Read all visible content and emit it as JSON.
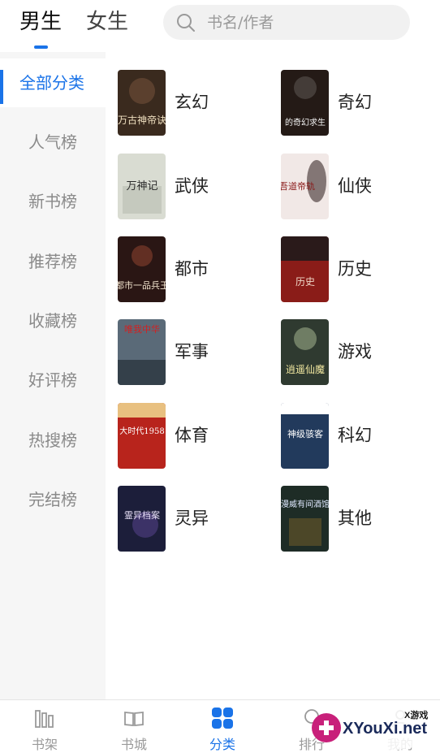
{
  "header": {
    "tabs": [
      {
        "label": "男生",
        "active": true
      },
      {
        "label": "女生",
        "active": false
      }
    ],
    "search": {
      "placeholder": "书名/作者",
      "value": ""
    }
  },
  "sidebar": {
    "items": [
      {
        "label": "全部分类",
        "active": true
      },
      {
        "label": "人气榜",
        "active": false
      },
      {
        "label": "新书榜",
        "active": false
      },
      {
        "label": "推荐榜",
        "active": false
      },
      {
        "label": "收藏榜",
        "active": false
      },
      {
        "label": "好评榜",
        "active": false
      },
      {
        "label": "热搜榜",
        "active": false
      },
      {
        "label": "完结榜",
        "active": false
      }
    ]
  },
  "categories": [
    {
      "label": "玄幻",
      "cover_text": "万古神帝诀",
      "cover_color": "#3a2a1e"
    },
    {
      "label": "奇幻",
      "cover_text": "的奇幻求生",
      "cover_color": "#241a16"
    },
    {
      "label": "武侠",
      "cover_text": "万神记",
      "cover_color": "#d9dcd2"
    },
    {
      "label": "仙侠",
      "cover_text": "吾道帝轨",
      "cover_color": "#f1e8e6"
    },
    {
      "label": "都市",
      "cover_text": "都市一品兵王",
      "cover_color": "#2a1614"
    },
    {
      "label": "历史",
      "cover_text": "历史",
      "cover_color": "#8a1c18"
    },
    {
      "label": "军事",
      "cover_text": "唯我中华",
      "cover_color": "#5a6a78"
    },
    {
      "label": "游戏",
      "cover_text": "逍遥仙魔",
      "cover_color": "#2f3a30"
    },
    {
      "label": "体育",
      "cover_text": "大时代1958",
      "cover_color": "#b8241c"
    },
    {
      "label": "科幻",
      "cover_text": "神级骇客",
      "cover_color": "#223a5c"
    },
    {
      "label": "灵异",
      "cover_text": "霊异档案",
      "cover_color": "#1c1e3a"
    },
    {
      "label": "其他",
      "cover_text": "漫威有间酒馆",
      "cover_color": "#1e2c26"
    }
  ],
  "bottom_nav": {
    "items": [
      {
        "label": "书架",
        "icon": "bookshelf-icon",
        "active": false
      },
      {
        "label": "书城",
        "icon": "book-open-icon",
        "active": false
      },
      {
        "label": "分类",
        "icon": "grid-icon",
        "active": true
      },
      {
        "label": "排行",
        "icon": "ranking-icon",
        "active": false
      },
      {
        "label": "我的",
        "icon": "user-icon",
        "active": false
      }
    ]
  },
  "watermark": {
    "text": "XYouXi.net",
    "small": "X游戏"
  },
  "colors": {
    "accent": "#1a73e8",
    "sidebar_bg": "#f6f6f6",
    "muted_text": "#8a8a8a"
  }
}
